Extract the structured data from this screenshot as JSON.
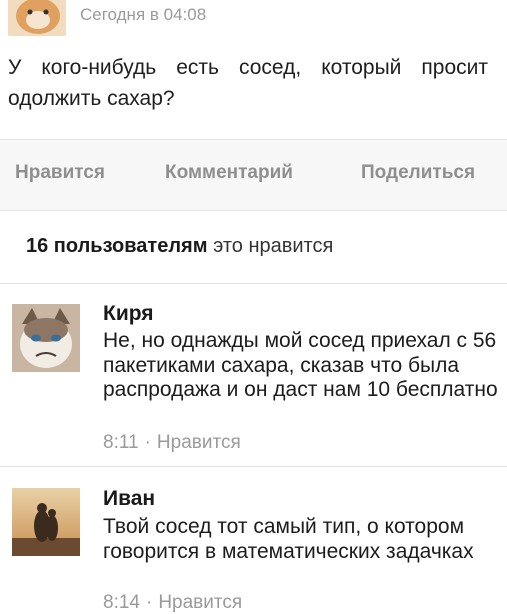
{
  "post": {
    "time": "Сегодня в 04:08",
    "text": "У кого-нибудь есть сосед, который просит одолжить сахар?"
  },
  "actions": {
    "like": "Нравится",
    "comment": "Комментарий",
    "share": "Поделиться"
  },
  "likes": {
    "count_bold": "16 пользователям",
    "suffix": "это нравится"
  },
  "comments": [
    {
      "name": "Киря",
      "text": "Не, но однажды мой сосед приехал с 56 пакетиками сахара, сказав что была распродажа и он даст нам 10 бесплатно",
      "time": "8:11",
      "like": "Нравится"
    },
    {
      "name": "Иван",
      "text": "Твой сосед тот самый тип, о котором говорится в математических задачках",
      "time": "8:14",
      "like": "Нравится"
    }
  ],
  "separator": "·"
}
